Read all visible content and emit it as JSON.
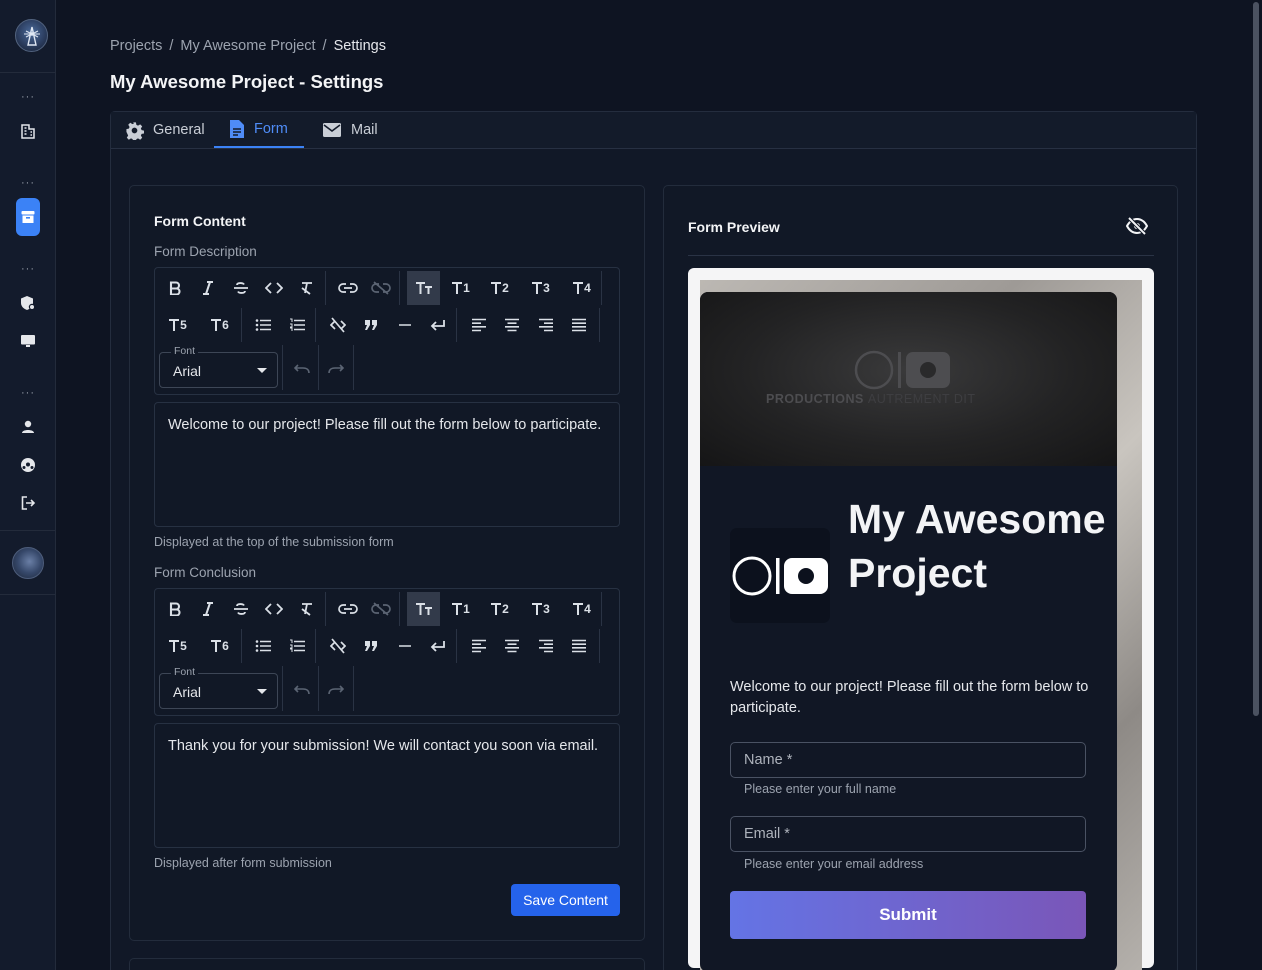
{
  "breadcrumb": {
    "items": [
      "Projects",
      "My Awesome Project"
    ],
    "separator": "/",
    "current": "Settings"
  },
  "page": {
    "title": "My Awesome Project - Settings"
  },
  "tabs": [
    {
      "label": "General",
      "icon": "gear-icon"
    },
    {
      "label": "Form",
      "icon": "document-icon",
      "active": true
    },
    {
      "label": "Mail",
      "icon": "mail-icon"
    }
  ],
  "sidebar": {
    "items": [
      "building-icon",
      "archive-icon",
      "shield-gear-icon",
      "monitor-icon",
      "user-icon",
      "soccer-ball-icon",
      "logout-icon"
    ],
    "active_item": "archive-icon",
    "dots": "···"
  },
  "form_content": {
    "title": "Form Content",
    "description": {
      "label": "Form Description",
      "text": "Welcome to our project! Please fill out the form below to participate.",
      "hint": "Displayed at the top of the submission form"
    },
    "conclusion": {
      "label": "Form Conclusion",
      "text": "Thank you for your submission! We will contact you soon via email.",
      "hint": "Displayed after form submission"
    },
    "toolbar": {
      "font_label": "Font",
      "font_value": "Arial",
      "headings": [
        "1",
        "2",
        "3",
        "4",
        "5",
        "6"
      ]
    },
    "save_label": "Save Content"
  },
  "preview": {
    "title": "Form Preview",
    "brand_bold": "PRODUCTIONS",
    "brand_thin": "AUTREMENT DIT",
    "form_title": "My Awesome Project",
    "description": "Welcome to our project! Please fill out the form below to participate.",
    "name_placeholder": "Name *",
    "name_hint": "Please enter your full name",
    "email_placeholder": "Email *",
    "email_hint": "Please enter your email address",
    "submit_label": "Submit"
  },
  "colors": {
    "accent": "#3b82f6",
    "primary_button": "#2563eb",
    "submit_gradient_start": "#6474e5",
    "submit_gradient_end": "#7a56b8"
  }
}
